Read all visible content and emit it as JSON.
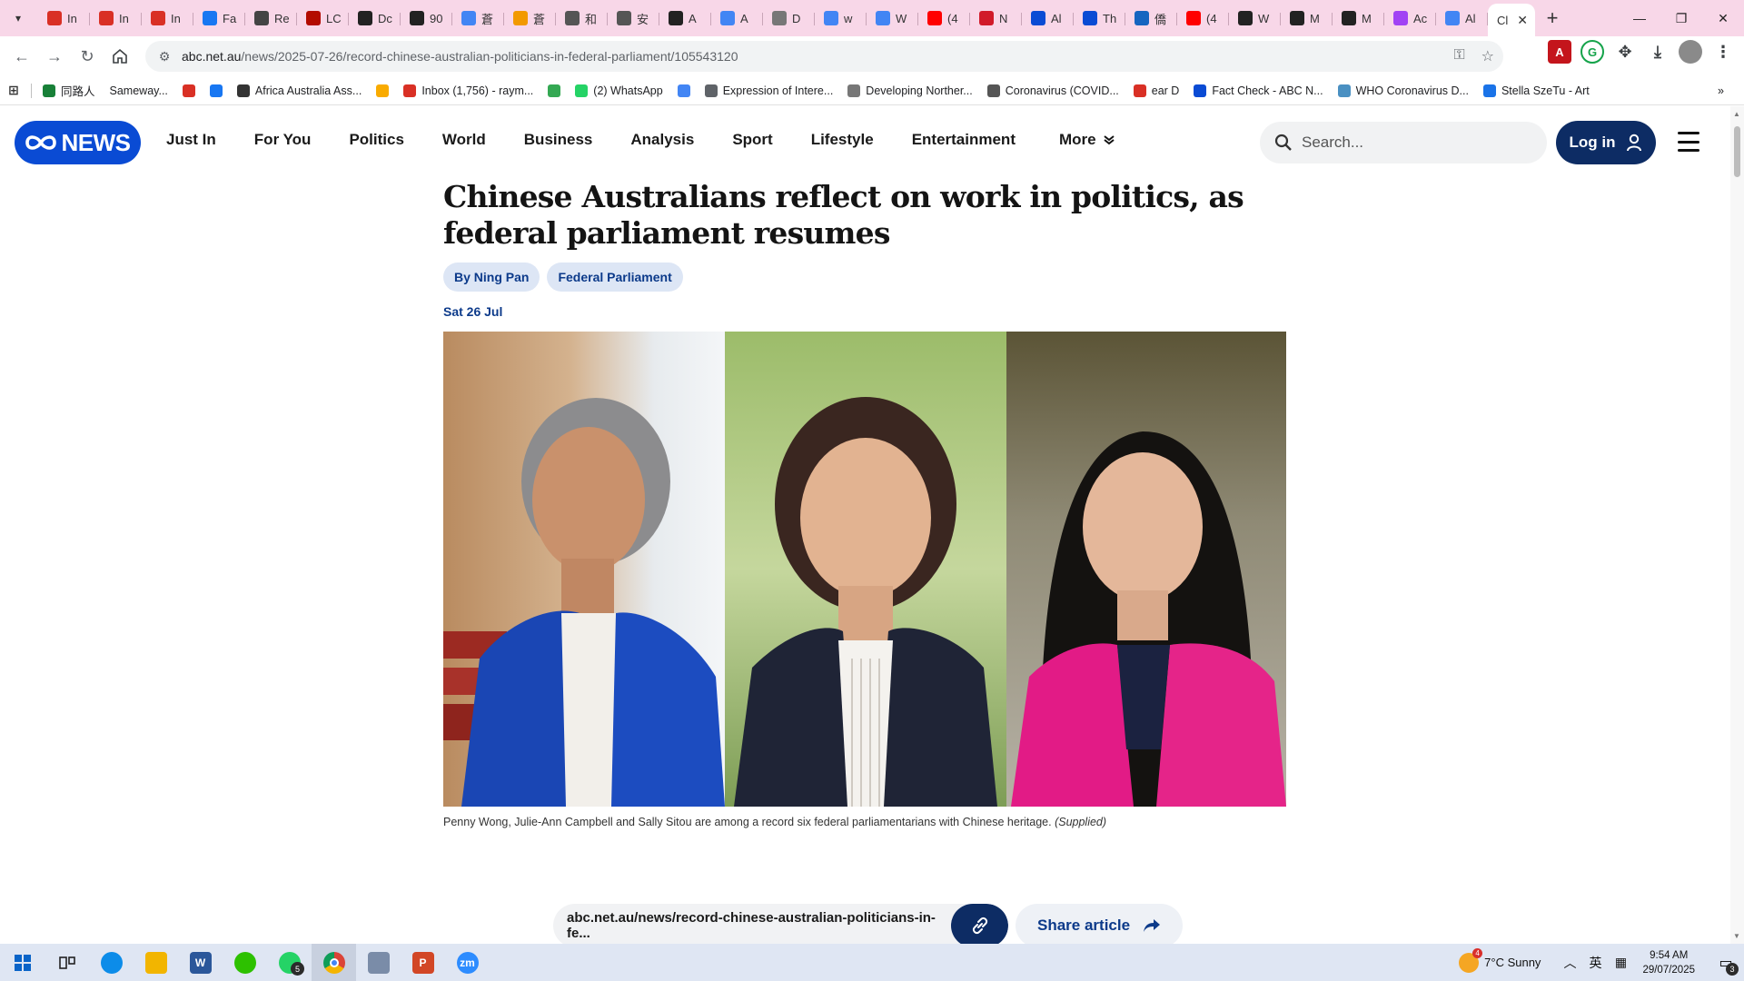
{
  "browser": {
    "tabs": [
      {
        "label": "In",
        "favicon": "gmail-icon",
        "color": "#d93025"
      },
      {
        "label": "In",
        "favicon": "gmail-icon",
        "color": "#d93025"
      },
      {
        "label": "In",
        "favicon": "gmail-icon",
        "color": "#d93025"
      },
      {
        "label": "Fa",
        "favicon": "facebook-icon",
        "color": "#1877f2"
      },
      {
        "label": "Re",
        "favicon": "globe-icon",
        "color": "#444444"
      },
      {
        "label": "LC",
        "favicon": "pdf-icon",
        "color": "#b30b00"
      },
      {
        "label": "Dc",
        "favicon": "pt-icon",
        "color": "#222222"
      },
      {
        "label": "90",
        "favicon": "pt-icon",
        "color": "#222222"
      },
      {
        "label": "蒼",
        "favicon": "google-icon",
        "color": "#4285f4"
      },
      {
        "label": "蒼",
        "favicon": "orange-circle-icon",
        "color": "#f29900"
      },
      {
        "label": "和",
        "favicon": "wikipedia-icon",
        "color": "#555555"
      },
      {
        "label": "安",
        "favicon": "wikipedia-icon",
        "color": "#555555"
      },
      {
        "label": "A",
        "favicon": "text-icon",
        "color": "#222222"
      },
      {
        "label": "A",
        "favicon": "google-icon",
        "color": "#4285f4"
      },
      {
        "label": "D",
        "favicon": "doc-icon",
        "color": "#777777"
      },
      {
        "label": "w",
        "favicon": "google-icon",
        "color": "#4285f4"
      },
      {
        "label": "W",
        "favicon": "google-icon",
        "color": "#4285f4"
      },
      {
        "label": "(4",
        "favicon": "youtube-icon",
        "color": "#ff0000"
      },
      {
        "label": "N",
        "favicon": "ts-icon",
        "color": "#d11a2a"
      },
      {
        "label": "Al",
        "favicon": "abc-icon",
        "color": "#0a4bd4"
      },
      {
        "label": "Th",
        "favicon": "abc-icon",
        "color": "#0a4bd4"
      },
      {
        "label": "僑",
        "favicon": "c-icon",
        "color": "#1565c0"
      },
      {
        "label": "(4",
        "favicon": "youtube-icon",
        "color": "#ff0000"
      },
      {
        "label": "W",
        "favicon": "news-icon",
        "color": "#222222"
      },
      {
        "label": "M",
        "favicon": "news-icon",
        "color": "#222222"
      },
      {
        "label": "M",
        "favicon": "news-icon",
        "color": "#222222"
      },
      {
        "label": "Ac",
        "favicon": "loading-icon",
        "color": "#a142f4"
      },
      {
        "label": "Al",
        "favicon": "google-icon",
        "color": "#4285f4"
      },
      {
        "label": "Cl",
        "favicon": "none",
        "color": "#ffffff",
        "active": true
      }
    ],
    "new_tab": "+",
    "url_host": "abc.net.au",
    "url_path": "/news/2025-07-26/record-chinese-australian-politicians-in-federal-parliament/105543120",
    "bookmarks": [
      {
        "label": "",
        "icon": "apps-grid-icon"
      },
      {
        "label": "同路人",
        "icon": "s-icon",
        "color": "#188038"
      },
      {
        "label": "Sameway...",
        "icon": "none",
        "color": "#ffffff"
      },
      {
        "label": "",
        "icon": "gmail-icon",
        "color": "#d93025"
      },
      {
        "label": "",
        "icon": "facebook-icon",
        "color": "#1877f2"
      },
      {
        "label": "Africa Australia Ass...",
        "icon": "globe-icon",
        "color": "#333333"
      },
      {
        "label": "",
        "icon": "drive-icon",
        "color": "#f9ab00"
      },
      {
        "label": "Inbox (1,756) - raym...",
        "icon": "gmail-icon",
        "color": "#d93025"
      },
      {
        "label": "",
        "icon": "pinwheel-icon",
        "color": "#34a853"
      },
      {
        "label": "(2) WhatsApp",
        "icon": "whatsapp-icon",
        "color": "#25d366"
      },
      {
        "label": "",
        "icon": "google-icon",
        "color": "#4285f4"
      },
      {
        "label": "Expression of Intere...",
        "icon": "globe-icon",
        "color": "#5f6368"
      },
      {
        "label": "Developing Norther...",
        "icon": "cloud-icon",
        "color": "#777777"
      },
      {
        "label": "Coronavirus (COVID...",
        "icon": "crest-icon",
        "color": "#555555"
      },
      {
        "label": "ear D",
        "icon": "gmail-icon",
        "color": "#d93025"
      },
      {
        "label": "Fact Check - ABC N...",
        "icon": "abc-icon",
        "color": "#0a4bd4"
      },
      {
        "label": "WHO Coronavirus D...",
        "icon": "globe-icon",
        "color": "#4a90c2"
      },
      {
        "label": "Stella SzeTu - Art",
        "icon": "stella-icon",
        "color": "#1a73e8"
      }
    ]
  },
  "site": {
    "logo_text": "NEWS",
    "nav": [
      "Just In",
      "For You",
      "Politics",
      "World",
      "Business",
      "Analysis",
      "Sport",
      "Lifestyle",
      "Entertainment"
    ],
    "more_label": "More",
    "search_placeholder": "Search...",
    "login_label": "Log in",
    "brand_color": "#0a4bd4",
    "dark_blue": "#0d2c64"
  },
  "article": {
    "headline": "Chinese Australians reflect on work in politics, as federal parliament resumes",
    "byline": "By Ning Pan",
    "topic": "Federal Parliament",
    "date": "Sat 26 Jul",
    "caption": "Penny Wong, Julie-Ann Campbell and Sally Sitou are among a record six federal parliamentarians with Chinese heritage.",
    "caption_credit": "(Supplied)",
    "share_url": "abc.net.au/news/record-chinese-australian-politicians-in-fe...",
    "share_label": "Share article"
  },
  "taskbar": {
    "apps": [
      {
        "name": "start",
        "color": "#0078d4"
      },
      {
        "name": "task-view",
        "color": "#333333"
      },
      {
        "name": "edge",
        "color": "#0c8ce9"
      },
      {
        "name": "file-explorer",
        "color": "#f2b500"
      },
      {
        "name": "word",
        "color": "#2b579a",
        "glyph": "W"
      },
      {
        "name": "wechat",
        "color": "#2dc100"
      },
      {
        "name": "whatsapp",
        "color": "#25d366",
        "badge": "5"
      },
      {
        "name": "chrome",
        "color": "#4285f4",
        "active": true
      },
      {
        "name": "snipping",
        "color": "#7a8ca8"
      },
      {
        "name": "powerpoint",
        "color": "#d24726",
        "glyph": "P"
      },
      {
        "name": "zoom",
        "color": "#2d8cff",
        "glyph": "zm"
      }
    ],
    "weather_badge": "4",
    "weather": "7°C  Sunny",
    "ime": "英",
    "time": "9:54 AM",
    "date": "29/07/2025",
    "notifications": "3"
  }
}
